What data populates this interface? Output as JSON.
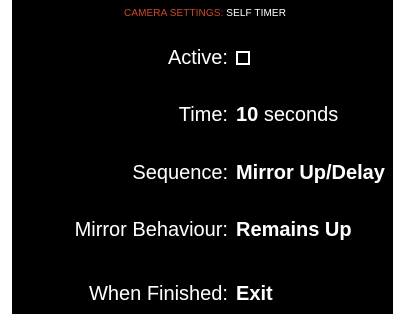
{
  "header": {
    "section": "CAMERA SETTINGS:",
    "subsection": "SELF TIMER"
  },
  "settings": {
    "active": {
      "label": "Active:",
      "checked": false
    },
    "time": {
      "label": "Time:",
      "value_number": "10",
      "value_unit": "seconds"
    },
    "sequence": {
      "label": "Sequence:",
      "value": "Mirror Up/Delay"
    },
    "mirror_behaviour": {
      "label": "Mirror Behaviour:",
      "value": "Remains Up"
    },
    "when_finished": {
      "label": "When Finished:",
      "value": "Exit"
    }
  },
  "colors": {
    "background": "#000000",
    "text": "#ffffff",
    "header_accent": "#d0482a"
  }
}
